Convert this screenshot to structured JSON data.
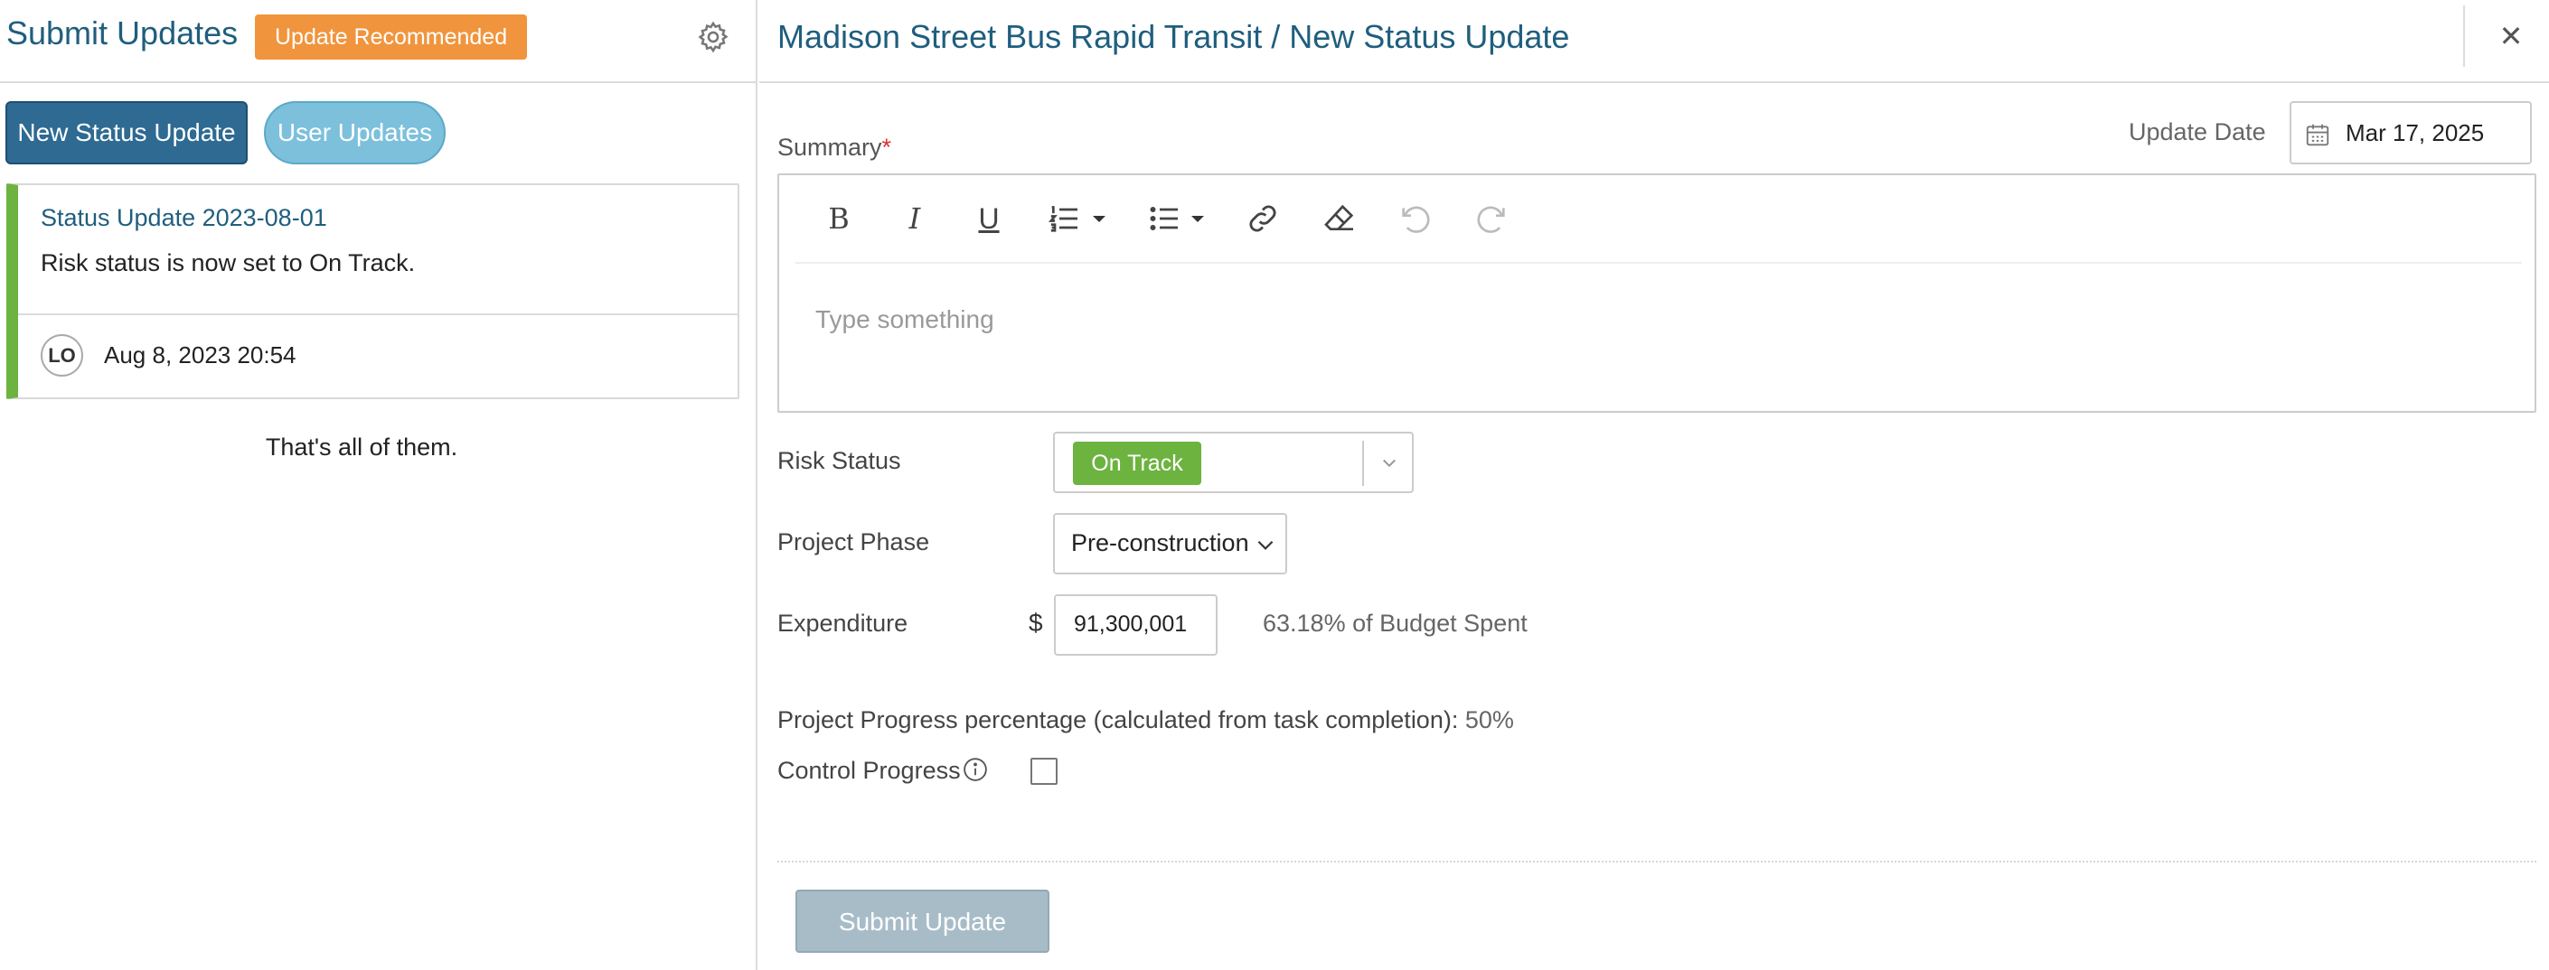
{
  "left_panel": {
    "title": "Submit Updates",
    "badge": "Update Recommended",
    "settings_icon": "gear-icon",
    "new_status_button": "New Status Update",
    "user_updates_button": "User Updates",
    "card": {
      "title": "Status Update 2023-08-01",
      "text": "Risk status is now set to On Track.",
      "avatar_initials": "LO",
      "timestamp": "Aug 8, 2023 20:54",
      "accent_color": "#6db33f"
    },
    "end_message": "That's all of them."
  },
  "right_panel": {
    "title": "Madison Street Bus Rapid Transit / New Status Update",
    "close_icon": "close-icon",
    "summary_label": "Summary",
    "required_marker": "*",
    "update_date_label": "Update Date",
    "update_date_value": "Mar 17, 2025",
    "editor_placeholder": "Type something",
    "toolbar": {
      "bold": "B",
      "italic": "I",
      "underline": "U"
    },
    "risk_status_label": "Risk Status",
    "risk_status_value": "On Track",
    "project_phase_label": "Project Phase",
    "project_phase_value": "Pre-construction",
    "expenditure_label": "Expenditure",
    "currency_symbol": "$",
    "expenditure_value": "91,300,001",
    "budget_text": "63.18% of Budget Spent",
    "progress_label": "Project Progress percentage (calculated from task completion):",
    "progress_value": "50%",
    "control_progress_label": "Control Progress",
    "submit_button": "Submit Update"
  },
  "colors": {
    "title_blue": "#1f5e7e",
    "primary_button": "#2e6a92",
    "secondary_button": "#7cc0dc",
    "badge_orange": "#f0953d",
    "status_green": "#6db33f",
    "submit_disabled": "#a8bcc8"
  }
}
